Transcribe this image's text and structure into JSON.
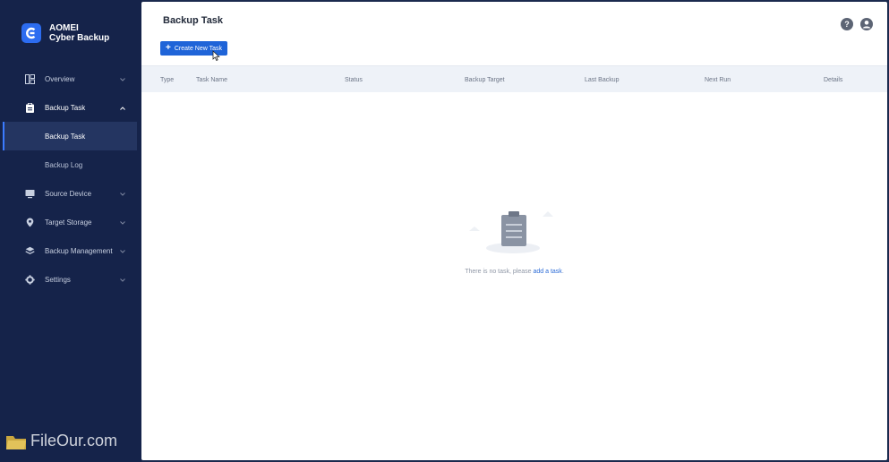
{
  "brand": {
    "line1": "AOMEI",
    "line2": "Cyber Backup",
    "logo_icon": "c-logo-icon",
    "accent": "#2c6cf0"
  },
  "sidebar": {
    "items": [
      {
        "label": "Overview",
        "icon": "dashboard-icon"
      },
      {
        "label": "Backup Task",
        "icon": "clipboard-icon",
        "open": true,
        "children": [
          {
            "label": "Backup Task",
            "active": true
          },
          {
            "label": "Backup Log",
            "active": false
          }
        ]
      },
      {
        "label": "Source Device",
        "icon": "monitor-icon"
      },
      {
        "label": "Target Storage",
        "icon": "location-pin-icon"
      },
      {
        "label": "Backup Management",
        "icon": "layers-icon"
      },
      {
        "label": "Settings",
        "icon": "gear-icon"
      }
    ]
  },
  "main": {
    "title": "Backup Task",
    "create_button": "Create New Task",
    "columns": [
      "Type",
      "Task Name",
      "Status",
      "Backup Target",
      "Last Backup",
      "Next Run",
      "Details"
    ],
    "empty_text": "There is no task, please",
    "empty_link": "add a task",
    "empty_suffix": "."
  },
  "header_icons": [
    "help-icon",
    "user-icon"
  ],
  "watermark": {
    "text": "FileOur.com"
  }
}
